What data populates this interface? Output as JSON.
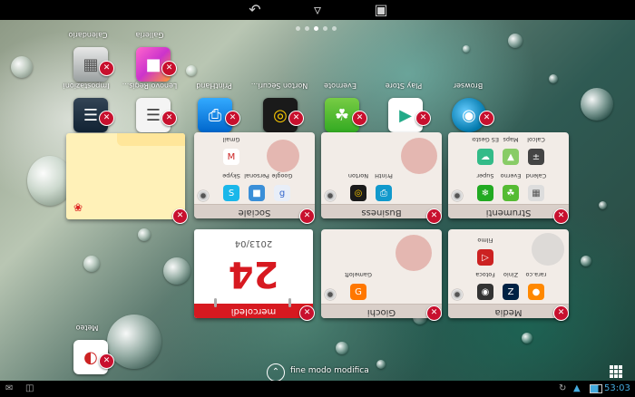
{
  "status_bar": {
    "time": "53:03",
    "wifi_icon": "wifi-icon",
    "battery_icon": "battery-icon",
    "sync_icon": "sync-icon"
  },
  "nav_bar": {
    "back_icon": "back-arrow-icon",
    "home_icon": "home-icon",
    "recents_icon": "recents-icon"
  },
  "home_pages": {
    "count": 5,
    "active": 2
  },
  "apps": [
    {
      "label": "Calendario",
      "icon": "calendar-app-icon"
    },
    {
      "label": "Galleria",
      "icon": "gallery-app-icon"
    },
    {
      "label": "Lenovo Regis...",
      "icon": "registration-app-icon"
    },
    {
      "label": "Impostazioni",
      "icon": "settings-app-icon"
    },
    {
      "label": "PrintHand",
      "icon": "printhand-app-icon"
    },
    {
      "label": "Norton Securi...",
      "icon": "norton-app-icon"
    },
    {
      "label": "Evernote",
      "icon": "evernote-app-icon"
    },
    {
      "label": "Play Store",
      "icon": "play-store-icon"
    },
    {
      "label": "Browser",
      "icon": "browser-app-icon"
    }
  ],
  "folders": {
    "sociale": {
      "name": "Sociale",
      "items": [
        "Skype",
        "Personal",
        "Google",
        "Gmail"
      ]
    },
    "business": {
      "name": "Business",
      "items": [
        "Norton",
        "PrintH"
      ]
    },
    "strumenti": {
      "name": "Strumenti",
      "items": [
        "Super",
        "Everno",
        "Calend",
        "ES Gestore",
        "Maps",
        "Calcol"
      ]
    },
    "giochi": {
      "name": "Giochi",
      "items": [
        "Gameloft"
      ]
    },
    "media": {
      "name": "Media",
      "items": [
        "Fotoca",
        "Zinio",
        "rara.co",
        "Filmo"
      ]
    }
  },
  "calendar_widget": {
    "date": "2013/04",
    "day": "24",
    "weekday": "mercoledì"
  },
  "edit_mode": {
    "label": "fine modo modifica"
  },
  "widget_bottom": {
    "label": "Meteo"
  },
  "colors": {
    "close_red": "#c8102e",
    "calendar_red": "#d71920"
  }
}
